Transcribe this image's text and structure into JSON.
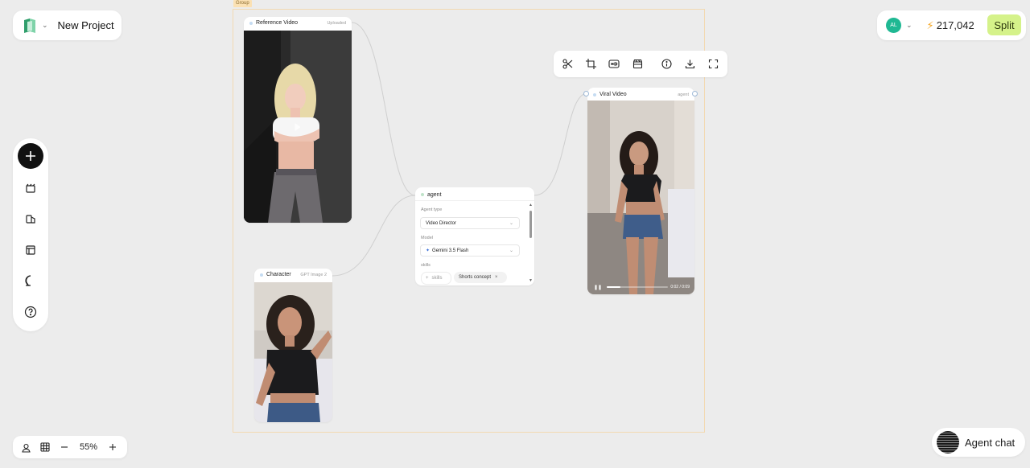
{
  "project": {
    "title": "New Project"
  },
  "account": {
    "avatar_initials": "AL",
    "credits": "217,042",
    "split_label": "Split"
  },
  "group": {
    "label": "Group"
  },
  "nodes": {
    "reference": {
      "title": "Reference Video",
      "tag": "Uploaded"
    },
    "character": {
      "title": "Character",
      "tag": "GPT Image 2"
    },
    "viral": {
      "title": "Viral Video",
      "tag": "agent",
      "time": "0:02 / 0:09",
      "progress": 0.22
    },
    "agent": {
      "title": "agent",
      "agent_type_label": "Agent type",
      "agent_type_value": "Video Director",
      "model_label": "Model",
      "model_value": "Gemini 3.5 Flash",
      "skills_label": "skills",
      "add_skill_label": "skills",
      "skill_chip": "Shorts concept"
    }
  },
  "zoom": {
    "level": "55%"
  },
  "agent_chat": {
    "label": "Agent chat"
  },
  "icons": {
    "left_toolbar": [
      "plus-icon",
      "media-icon",
      "assets-icon",
      "layout-icon",
      "chat-icon",
      "help-icon"
    ],
    "image_toolbar": [
      "scissors-icon",
      "crop-icon",
      "hd-icon",
      "clapper-icon",
      "info-icon",
      "download-icon",
      "fullscreen-icon"
    ],
    "zoom_bar": [
      "person-pin-icon",
      "grid-icon",
      "minus-icon",
      "plus-icon"
    ]
  },
  "colors": {
    "accent_split": "#d5f28a",
    "avatar": "#1fb893",
    "bolt": "#f5a623",
    "group_border": "#f2d9b2"
  }
}
